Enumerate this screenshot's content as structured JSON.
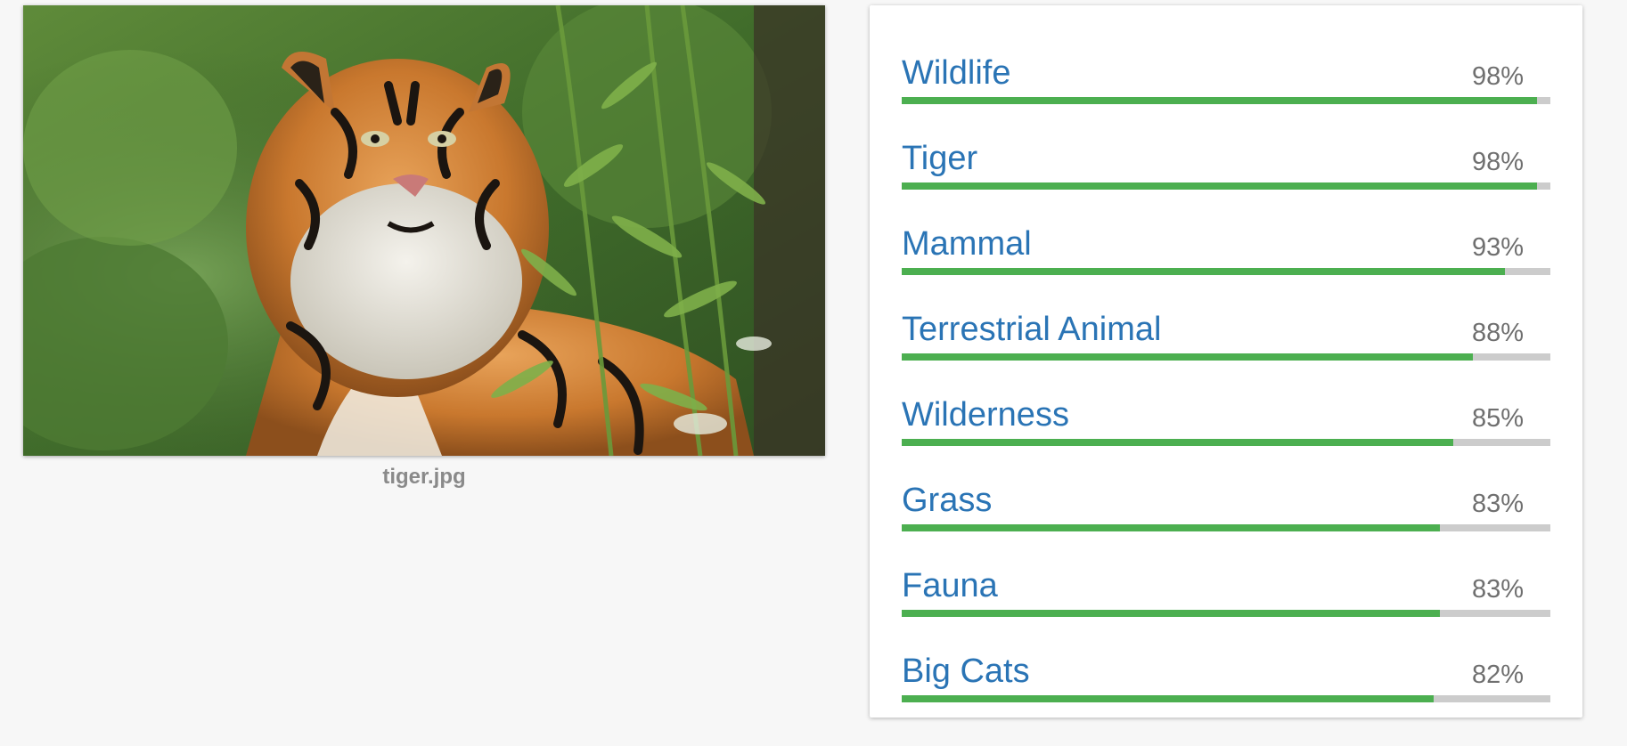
{
  "image": {
    "filename": "tiger.jpg",
    "subject_icon": "tiger-photo"
  },
  "colors": {
    "label_text": "#2a74b5",
    "score_text": "#6f6f6f",
    "bar_fill": "#4caf50",
    "bar_track": "#cccccc",
    "background": "#f7f7f7"
  },
  "labels": [
    {
      "name": "Wildlife",
      "score": "98%",
      "value": 0.98
    },
    {
      "name": "Tiger",
      "score": "98%",
      "value": 0.98
    },
    {
      "name": "Mammal",
      "score": "93%",
      "value": 0.93
    },
    {
      "name": "Terrestrial Animal",
      "score": "88%",
      "value": 0.88
    },
    {
      "name": "Wilderness",
      "score": "85%",
      "value": 0.85
    },
    {
      "name": "Grass",
      "score": "83%",
      "value": 0.83
    },
    {
      "name": "Fauna",
      "score": "83%",
      "value": 0.83
    },
    {
      "name": "Big Cats",
      "score": "82%",
      "value": 0.82
    }
  ]
}
